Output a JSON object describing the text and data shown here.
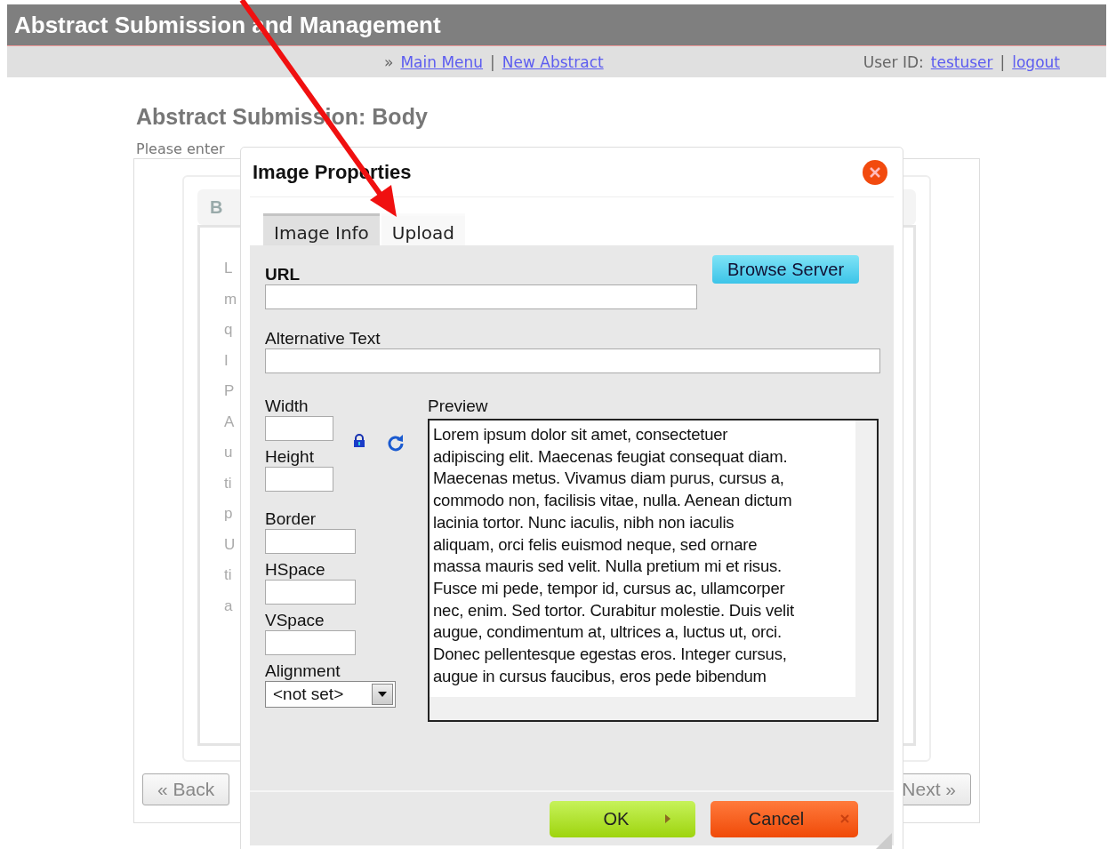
{
  "header": {
    "title": "Abstract Submission and Management"
  },
  "nav": {
    "prefix": "»",
    "links": [
      {
        "label": "Main Menu"
      },
      {
        "label": "New Abstract"
      }
    ],
    "separator": "|",
    "user_label": "User ID:",
    "user": "testuser",
    "user_separator": "|",
    "logout": "logout"
  },
  "page": {
    "heading": "Abstract Submission: Body",
    "instruction": "Please enter",
    "toolbar_bold": "B",
    "editor_lines": [
      "L",
      "m",
      "q",
      "I",
      "P",
      "A",
      "u",
      "ti",
      "p",
      "U",
      "ti",
      "a"
    ],
    "back_button": "« Back",
    "next_button": "Next »"
  },
  "dialog": {
    "title": "Image Properties",
    "tabs": [
      {
        "label": "Image Info",
        "selected": true
      },
      {
        "label": "Upload",
        "selected": false
      }
    ],
    "url_label": "URL",
    "browse_button": "Browse Server",
    "alt_label": "Alternative Text",
    "fields": [
      {
        "label": "Width"
      },
      {
        "label": "Height"
      },
      {
        "label": "Border"
      },
      {
        "label": "HSpace"
      },
      {
        "label": "VSpace"
      }
    ],
    "alignment_label": "Alignment",
    "alignment_value": "<not set>",
    "preview_label": "Preview",
    "preview_lines": [
      "Lorem ipsum dolor sit amet, consectetuer",
      "adipiscing elit. Maecenas feugiat consequat diam.",
      "Maecenas metus. Vivamus diam purus, cursus a,",
      "commodo non, facilisis vitae, nulla. Aenean dictum",
      "lacinia tortor. Nunc iaculis, nibh non iaculis",
      "aliquam, orci felis euismod neque, sed ornare",
      "massa mauris sed velit. Nulla pretium mi et risus.",
      "Fusce mi pede, tempor id, cursus ac, ullamcorper",
      "nec, enim. Sed tortor. Curabitur molestie. Duis velit",
      "augue, condimentum at, ultrices a, luctus ut, orci.",
      "Donec pellentesque egestas eros. Integer cursus,",
      "augue in cursus faucibus, eros pede bibendum"
    ],
    "ok_button": "OK",
    "cancel_button": "Cancel"
  }
}
